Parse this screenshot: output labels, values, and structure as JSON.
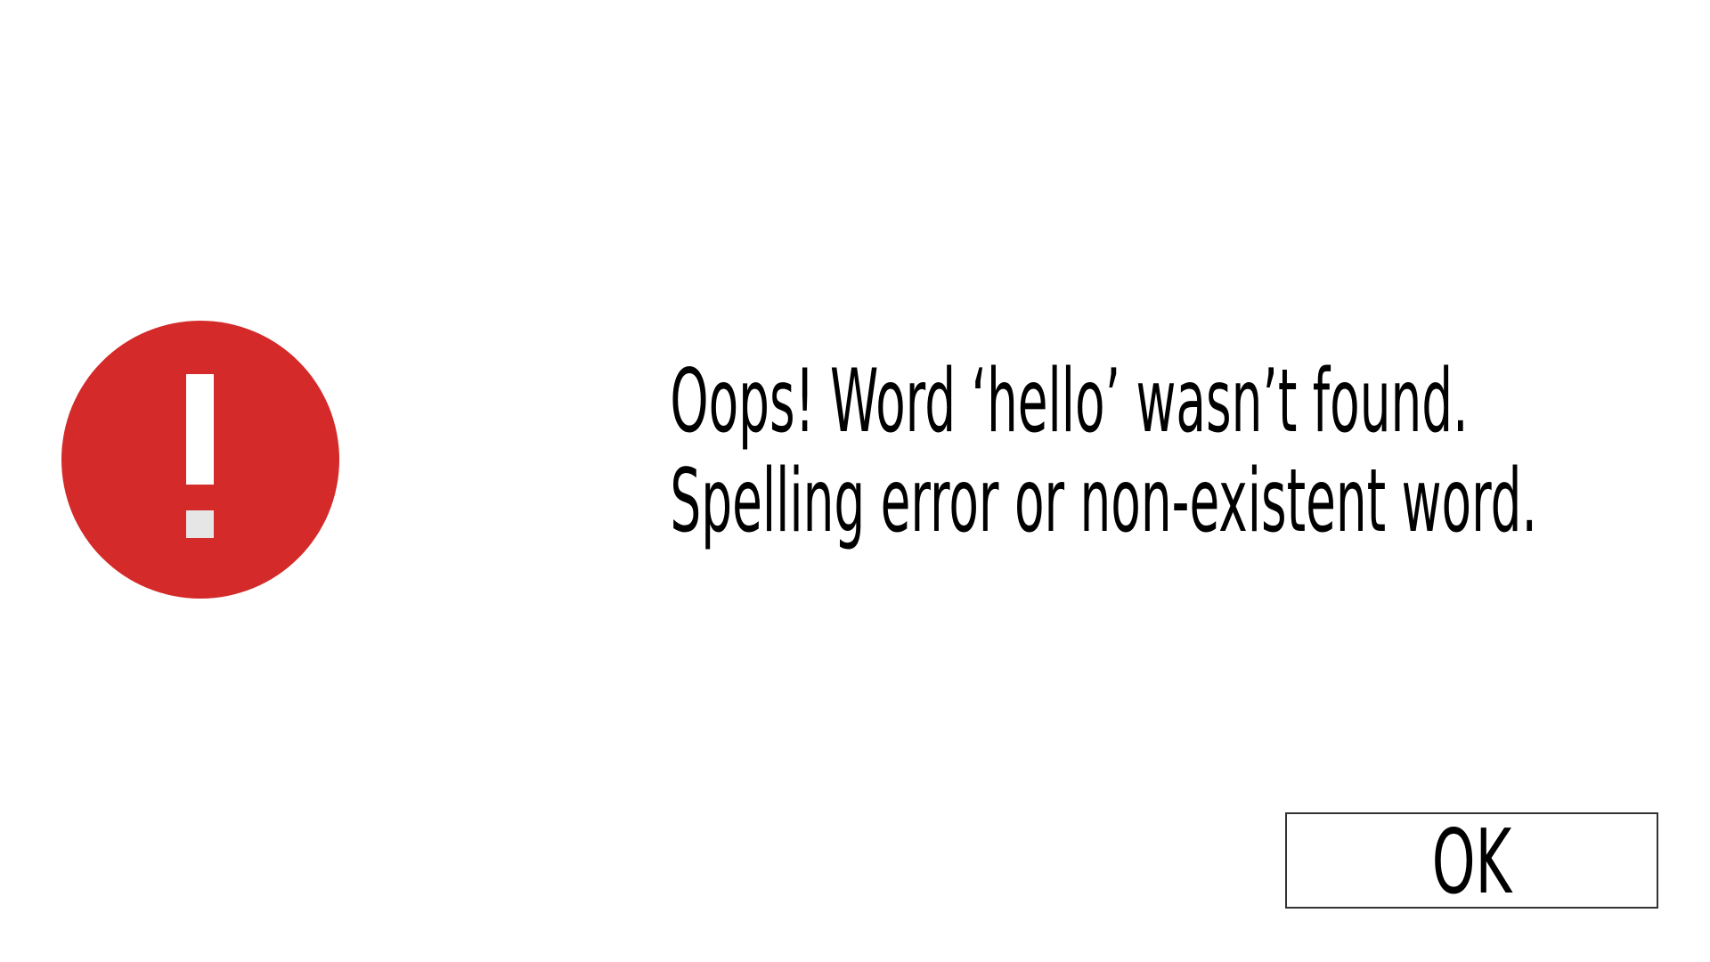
{
  "dialog": {
    "icon": "exclamation-alert-icon",
    "icon_color": "#d42a2a",
    "message_lines": [
      "Oops! Word ‘hello’ wasn’t found.",
      "Spelling error or non-existent word."
    ],
    "ok_label": "OK"
  }
}
